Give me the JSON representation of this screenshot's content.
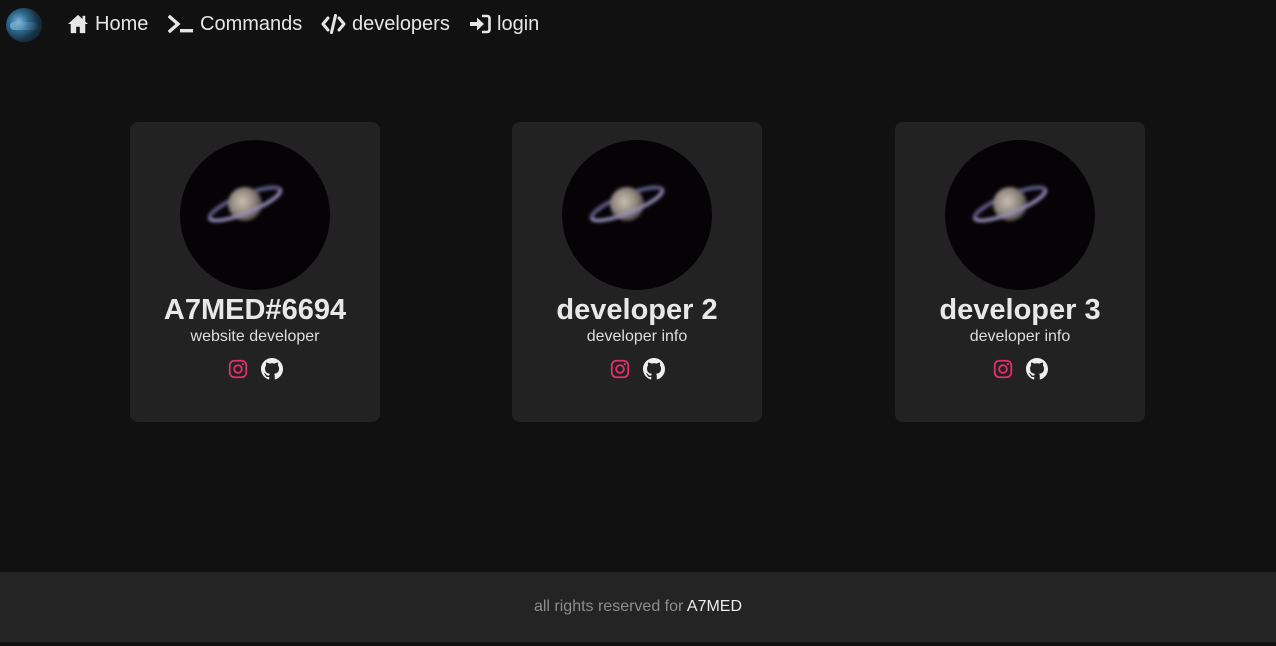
{
  "nav": {
    "items": [
      {
        "label": "Home",
        "icon": "home-icon"
      },
      {
        "label": "Commands",
        "icon": "terminal-icon"
      },
      {
        "label": "developers",
        "icon": "code-icon"
      },
      {
        "label": "login",
        "icon": "sign-in-icon"
      }
    ]
  },
  "developers": [
    {
      "name": "A7MED#6694",
      "info": "website developer",
      "avatar": "saturn-image"
    },
    {
      "name": "developer 2",
      "info": "developer info",
      "avatar": "saturn-image"
    },
    {
      "name": "developer 3",
      "info": "developer info",
      "avatar": "saturn-image"
    }
  ],
  "socials": {
    "instagram": {
      "icon": "instagram-icon",
      "color": "#e1306c"
    },
    "github": {
      "icon": "github-icon",
      "color": "#eeeeee"
    }
  },
  "footer": {
    "text": "all rights reserved for",
    "owner": "A7MED"
  },
  "colors": {
    "background": "#111111",
    "card": "#222222",
    "footer": "#242424"
  }
}
